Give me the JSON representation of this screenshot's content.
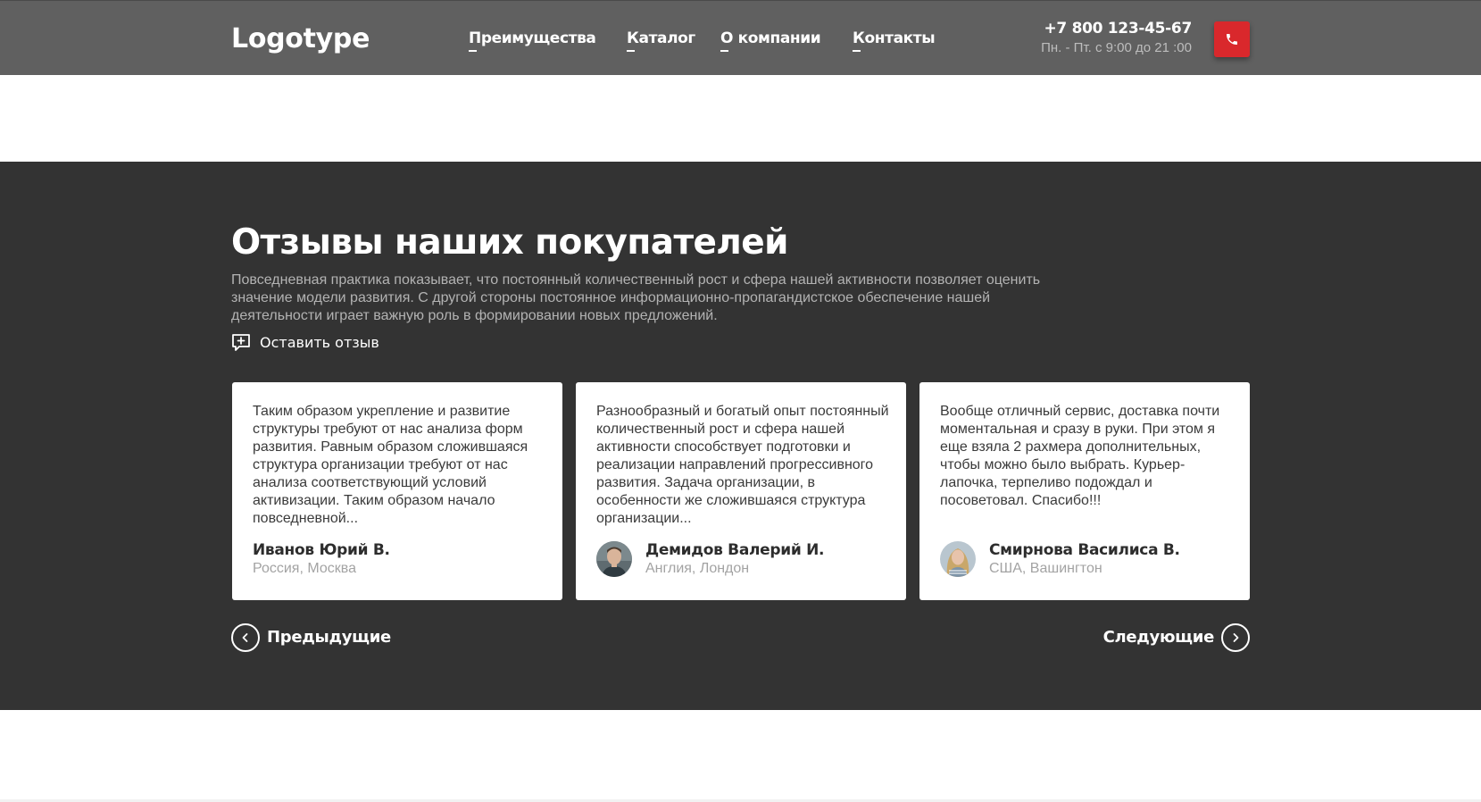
{
  "header": {
    "logo": "Logotype",
    "nav": [
      {
        "label": "Преимущества"
      },
      {
        "label": "Каталог"
      },
      {
        "label": "О компании"
      },
      {
        "label": "Контакты"
      }
    ],
    "phone": "+7 800 123-45-67",
    "hours": "Пн. - Пт. с 9:00 до 21 :00",
    "call_icon": "phone-icon"
  },
  "reviews": {
    "title": "Отзывы наших покупателей",
    "description": "Повседневная практика показывает, что постоянный количественный рост и сфера нашей активности позволяет оценить значение модели развития. С другой стороны постоянное информационно-пропагандистское обеспечение нашей деятельности играет важную роль в формировании новых предложений.",
    "leave_review": "Оставить отзыв",
    "leave_review_icon": "add-comment-icon",
    "cards": [
      {
        "text": "Таким образом укрепление и развитие структуры требуют от нас анализа форм развития. Равным образом сложившаяся структура организации требуют от нас анализа соответствующий условий активизации. Таким образом начало повседневной...",
        "name": "Иванов Юрий В.",
        "location": "Россия, Москва",
        "has_avatar": false
      },
      {
        "text": "Разнообразный и богатый опыт постоянный количественный рост и сфера нашей активности способствует подготовки и реализации направлений прогрессивного развития. Задача организации, в особенности же сложившаяся структура организации...",
        "name": "Демидов Валерий И.",
        "location": "Англия, Лондон",
        "has_avatar": true
      },
      {
        "text": "Вообще отличный сервис, доставка почти моментальная и сразу в руки. При этом я еще взяла 2 рахмера дополнительных, чтобы можно было выбрать. Курьер-лапочка, терпеливо подождал и посоветовал. Спасибо!!!",
        "name": "Смирнова Василиса В.",
        "location": "США, Вашингтон",
        "has_avatar": true
      }
    ],
    "prev": "Предыдущие",
    "next": "Следующие"
  },
  "colors": {
    "header_bg": "#606060",
    "section_bg": "#333333",
    "accent_red": "#d9282c"
  }
}
